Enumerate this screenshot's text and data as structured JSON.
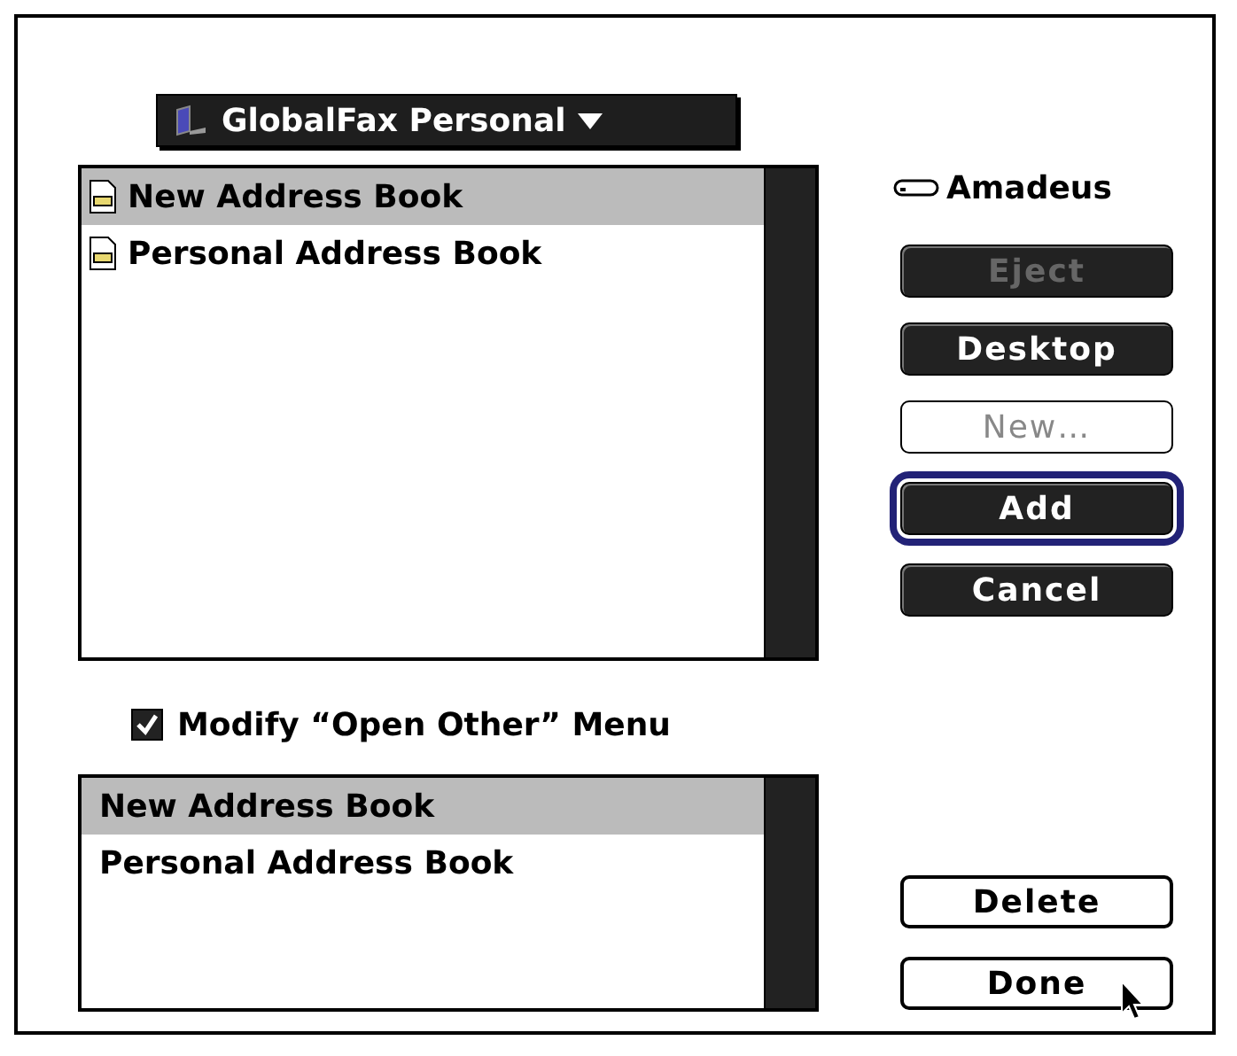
{
  "popup": {
    "label": "GlobalFax Personal"
  },
  "file_list": {
    "items": [
      {
        "name": "New Address Book",
        "selected": true
      },
      {
        "name": "Personal Address Book",
        "selected": false
      }
    ]
  },
  "volume": {
    "name": "Amadeus"
  },
  "buttons": [
    {
      "label": "Eject",
      "kind": "filled",
      "disabled": true,
      "default": false
    },
    {
      "label": "Desktop",
      "kind": "filled",
      "disabled": false,
      "default": false
    },
    {
      "label": "New…",
      "kind": "outline",
      "disabled": true,
      "default": false
    },
    {
      "label": "Add",
      "kind": "filled",
      "disabled": false,
      "default": true
    },
    {
      "label": "Cancel",
      "kind": "filled",
      "disabled": false,
      "default": false
    }
  ],
  "checkbox": {
    "label": "Modify “Open Other” Menu",
    "checked": true
  },
  "menu_list": {
    "items": [
      {
        "name": "New Address Book",
        "selected": true
      },
      {
        "name": "Personal Address Book",
        "selected": false
      }
    ]
  },
  "bottom_buttons": [
    {
      "label": "Delete",
      "kind": "outline",
      "disabled": false,
      "default": false
    },
    {
      "label": "Done",
      "kind": "outline",
      "disabled": false,
      "default": false
    }
  ]
}
